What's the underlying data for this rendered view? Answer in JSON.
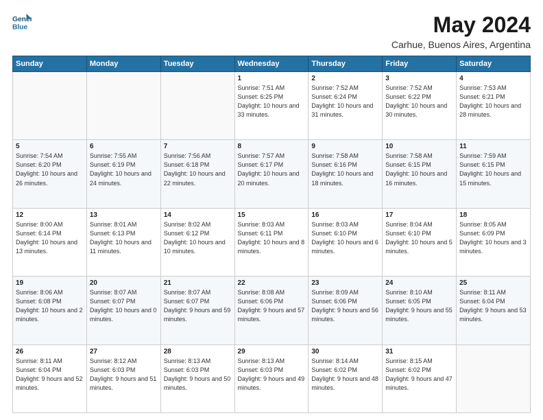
{
  "logo": {
    "line1": "General",
    "line2": "Blue"
  },
  "title": "May 2024",
  "subtitle": "Carhue, Buenos Aires, Argentina",
  "weekdays": [
    "Sunday",
    "Monday",
    "Tuesday",
    "Wednesday",
    "Thursday",
    "Friday",
    "Saturday"
  ],
  "weeks": [
    [
      {
        "day": "",
        "sunrise": "",
        "sunset": "",
        "daylight": ""
      },
      {
        "day": "",
        "sunrise": "",
        "sunset": "",
        "daylight": ""
      },
      {
        "day": "",
        "sunrise": "",
        "sunset": "",
        "daylight": ""
      },
      {
        "day": "1",
        "sunrise": "Sunrise: 7:51 AM",
        "sunset": "Sunset: 6:25 PM",
        "daylight": "Daylight: 10 hours and 33 minutes."
      },
      {
        "day": "2",
        "sunrise": "Sunrise: 7:52 AM",
        "sunset": "Sunset: 6:24 PM",
        "daylight": "Daylight: 10 hours and 31 minutes."
      },
      {
        "day": "3",
        "sunrise": "Sunrise: 7:52 AM",
        "sunset": "Sunset: 6:22 PM",
        "daylight": "Daylight: 10 hours and 30 minutes."
      },
      {
        "day": "4",
        "sunrise": "Sunrise: 7:53 AM",
        "sunset": "Sunset: 6:21 PM",
        "daylight": "Daylight: 10 hours and 28 minutes."
      }
    ],
    [
      {
        "day": "5",
        "sunrise": "Sunrise: 7:54 AM",
        "sunset": "Sunset: 6:20 PM",
        "daylight": "Daylight: 10 hours and 26 minutes."
      },
      {
        "day": "6",
        "sunrise": "Sunrise: 7:55 AM",
        "sunset": "Sunset: 6:19 PM",
        "daylight": "Daylight: 10 hours and 24 minutes."
      },
      {
        "day": "7",
        "sunrise": "Sunrise: 7:56 AM",
        "sunset": "Sunset: 6:18 PM",
        "daylight": "Daylight: 10 hours and 22 minutes."
      },
      {
        "day": "8",
        "sunrise": "Sunrise: 7:57 AM",
        "sunset": "Sunset: 6:17 PM",
        "daylight": "Daylight: 10 hours and 20 minutes."
      },
      {
        "day": "9",
        "sunrise": "Sunrise: 7:58 AM",
        "sunset": "Sunset: 6:16 PM",
        "daylight": "Daylight: 10 hours and 18 minutes."
      },
      {
        "day": "10",
        "sunrise": "Sunrise: 7:58 AM",
        "sunset": "Sunset: 6:15 PM",
        "daylight": "Daylight: 10 hours and 16 minutes."
      },
      {
        "day": "11",
        "sunrise": "Sunrise: 7:59 AM",
        "sunset": "Sunset: 6:15 PM",
        "daylight": "Daylight: 10 hours and 15 minutes."
      }
    ],
    [
      {
        "day": "12",
        "sunrise": "Sunrise: 8:00 AM",
        "sunset": "Sunset: 6:14 PM",
        "daylight": "Daylight: 10 hours and 13 minutes."
      },
      {
        "day": "13",
        "sunrise": "Sunrise: 8:01 AM",
        "sunset": "Sunset: 6:13 PM",
        "daylight": "Daylight: 10 hours and 11 minutes."
      },
      {
        "day": "14",
        "sunrise": "Sunrise: 8:02 AM",
        "sunset": "Sunset: 6:12 PM",
        "daylight": "Daylight: 10 hours and 10 minutes."
      },
      {
        "day": "15",
        "sunrise": "Sunrise: 8:03 AM",
        "sunset": "Sunset: 6:11 PM",
        "daylight": "Daylight: 10 hours and 8 minutes."
      },
      {
        "day": "16",
        "sunrise": "Sunrise: 8:03 AM",
        "sunset": "Sunset: 6:10 PM",
        "daylight": "Daylight: 10 hours and 6 minutes."
      },
      {
        "day": "17",
        "sunrise": "Sunrise: 8:04 AM",
        "sunset": "Sunset: 6:10 PM",
        "daylight": "Daylight: 10 hours and 5 minutes."
      },
      {
        "day": "18",
        "sunrise": "Sunrise: 8:05 AM",
        "sunset": "Sunset: 6:09 PM",
        "daylight": "Daylight: 10 hours and 3 minutes."
      }
    ],
    [
      {
        "day": "19",
        "sunrise": "Sunrise: 8:06 AM",
        "sunset": "Sunset: 6:08 PM",
        "daylight": "Daylight: 10 hours and 2 minutes."
      },
      {
        "day": "20",
        "sunrise": "Sunrise: 8:07 AM",
        "sunset": "Sunset: 6:07 PM",
        "daylight": "Daylight: 10 hours and 0 minutes."
      },
      {
        "day": "21",
        "sunrise": "Sunrise: 8:07 AM",
        "sunset": "Sunset: 6:07 PM",
        "daylight": "Daylight: 9 hours and 59 minutes."
      },
      {
        "day": "22",
        "sunrise": "Sunrise: 8:08 AM",
        "sunset": "Sunset: 6:06 PM",
        "daylight": "Daylight: 9 hours and 57 minutes."
      },
      {
        "day": "23",
        "sunrise": "Sunrise: 8:09 AM",
        "sunset": "Sunset: 6:06 PM",
        "daylight": "Daylight: 9 hours and 56 minutes."
      },
      {
        "day": "24",
        "sunrise": "Sunrise: 8:10 AM",
        "sunset": "Sunset: 6:05 PM",
        "daylight": "Daylight: 9 hours and 55 minutes."
      },
      {
        "day": "25",
        "sunrise": "Sunrise: 8:11 AM",
        "sunset": "Sunset: 6:04 PM",
        "daylight": "Daylight: 9 hours and 53 minutes."
      }
    ],
    [
      {
        "day": "26",
        "sunrise": "Sunrise: 8:11 AM",
        "sunset": "Sunset: 6:04 PM",
        "daylight": "Daylight: 9 hours and 52 minutes."
      },
      {
        "day": "27",
        "sunrise": "Sunrise: 8:12 AM",
        "sunset": "Sunset: 6:03 PM",
        "daylight": "Daylight: 9 hours and 51 minutes."
      },
      {
        "day": "28",
        "sunrise": "Sunrise: 8:13 AM",
        "sunset": "Sunset: 6:03 PM",
        "daylight": "Daylight: 9 hours and 50 minutes."
      },
      {
        "day": "29",
        "sunrise": "Sunrise: 8:13 AM",
        "sunset": "Sunset: 6:03 PM",
        "daylight": "Daylight: 9 hours and 49 minutes."
      },
      {
        "day": "30",
        "sunrise": "Sunrise: 8:14 AM",
        "sunset": "Sunset: 6:02 PM",
        "daylight": "Daylight: 9 hours and 48 minutes."
      },
      {
        "day": "31",
        "sunrise": "Sunrise: 8:15 AM",
        "sunset": "Sunset: 6:02 PM",
        "daylight": "Daylight: 9 hours and 47 minutes."
      },
      {
        "day": "",
        "sunrise": "",
        "sunset": "",
        "daylight": ""
      }
    ]
  ]
}
